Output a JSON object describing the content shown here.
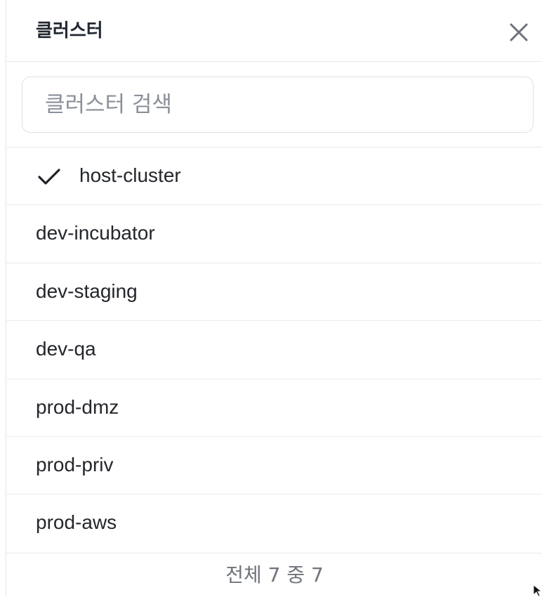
{
  "panel": {
    "title": "클러스터",
    "close_icon": "close-icon"
  },
  "search": {
    "placeholder": "클러스터 검색",
    "value": ""
  },
  "clusters": [
    {
      "label": "host-cluster",
      "selected": true
    },
    {
      "label": "dev-incubator",
      "selected": false
    },
    {
      "label": "dev-staging",
      "selected": false
    },
    {
      "label": "dev-qa",
      "selected": false
    },
    {
      "label": "prod-dmz",
      "selected": false
    },
    {
      "label": "prod-priv",
      "selected": false
    },
    {
      "label": "prod-aws",
      "selected": false
    }
  ],
  "footer": {
    "count_text": "전체 7 중 7"
  }
}
